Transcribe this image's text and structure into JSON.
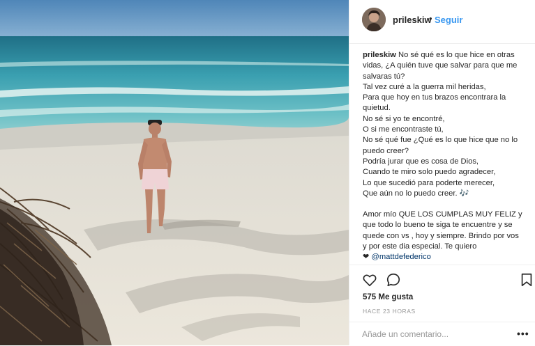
{
  "post": {
    "username": "prileskiw",
    "follow_dot": "•",
    "follow_label": "Seguir",
    "caption": {
      "username": "prileskiw",
      "first_line": "No sé qué es lo que hice en otras vidas, ¿A quién tuve que salvar para que me salvaras tú?",
      "lines": [
        "Tal vez curé a la guerra mil heridas,",
        "Para que hoy en tus brazos encontrara la quietud.",
        "No sé si yo te encontré,",
        "O si me encontraste tú,",
        "No sé qué fue ¿Qué es lo que hice que no lo puedo creer?",
        "Podría jurar que es cosa de Dios,",
        "Cuando te miro solo puedo agradecer,",
        "Lo que sucedió para poderte merecer,",
        "Que aún no lo puedo creer. 🎶"
      ],
      "paragraph2": "Amor mío QUE LOS CUMPLAS MUY FELIZ y que todo lo bueno te siga te encuentre y se quede con vs , hoy y siempre. Brindo por vos y por este dia especial. Te quiero",
      "heart": "❤",
      "mention": "@mattdefederico"
    },
    "likes": "575 Me gusta",
    "time": "HACE 23 HORAS",
    "comment_placeholder": "Añade un comentario...",
    "more": "•••"
  },
  "icons": {
    "like": "heart-outline-icon",
    "comment": "speech-bubble-icon",
    "save": "bookmark-icon",
    "options": "ellipsis-icon"
  },
  "colors": {
    "link": "#3897f0",
    "mention": "#003569",
    "muted": "#999999",
    "text": "#262626",
    "border": "#efefef"
  }
}
